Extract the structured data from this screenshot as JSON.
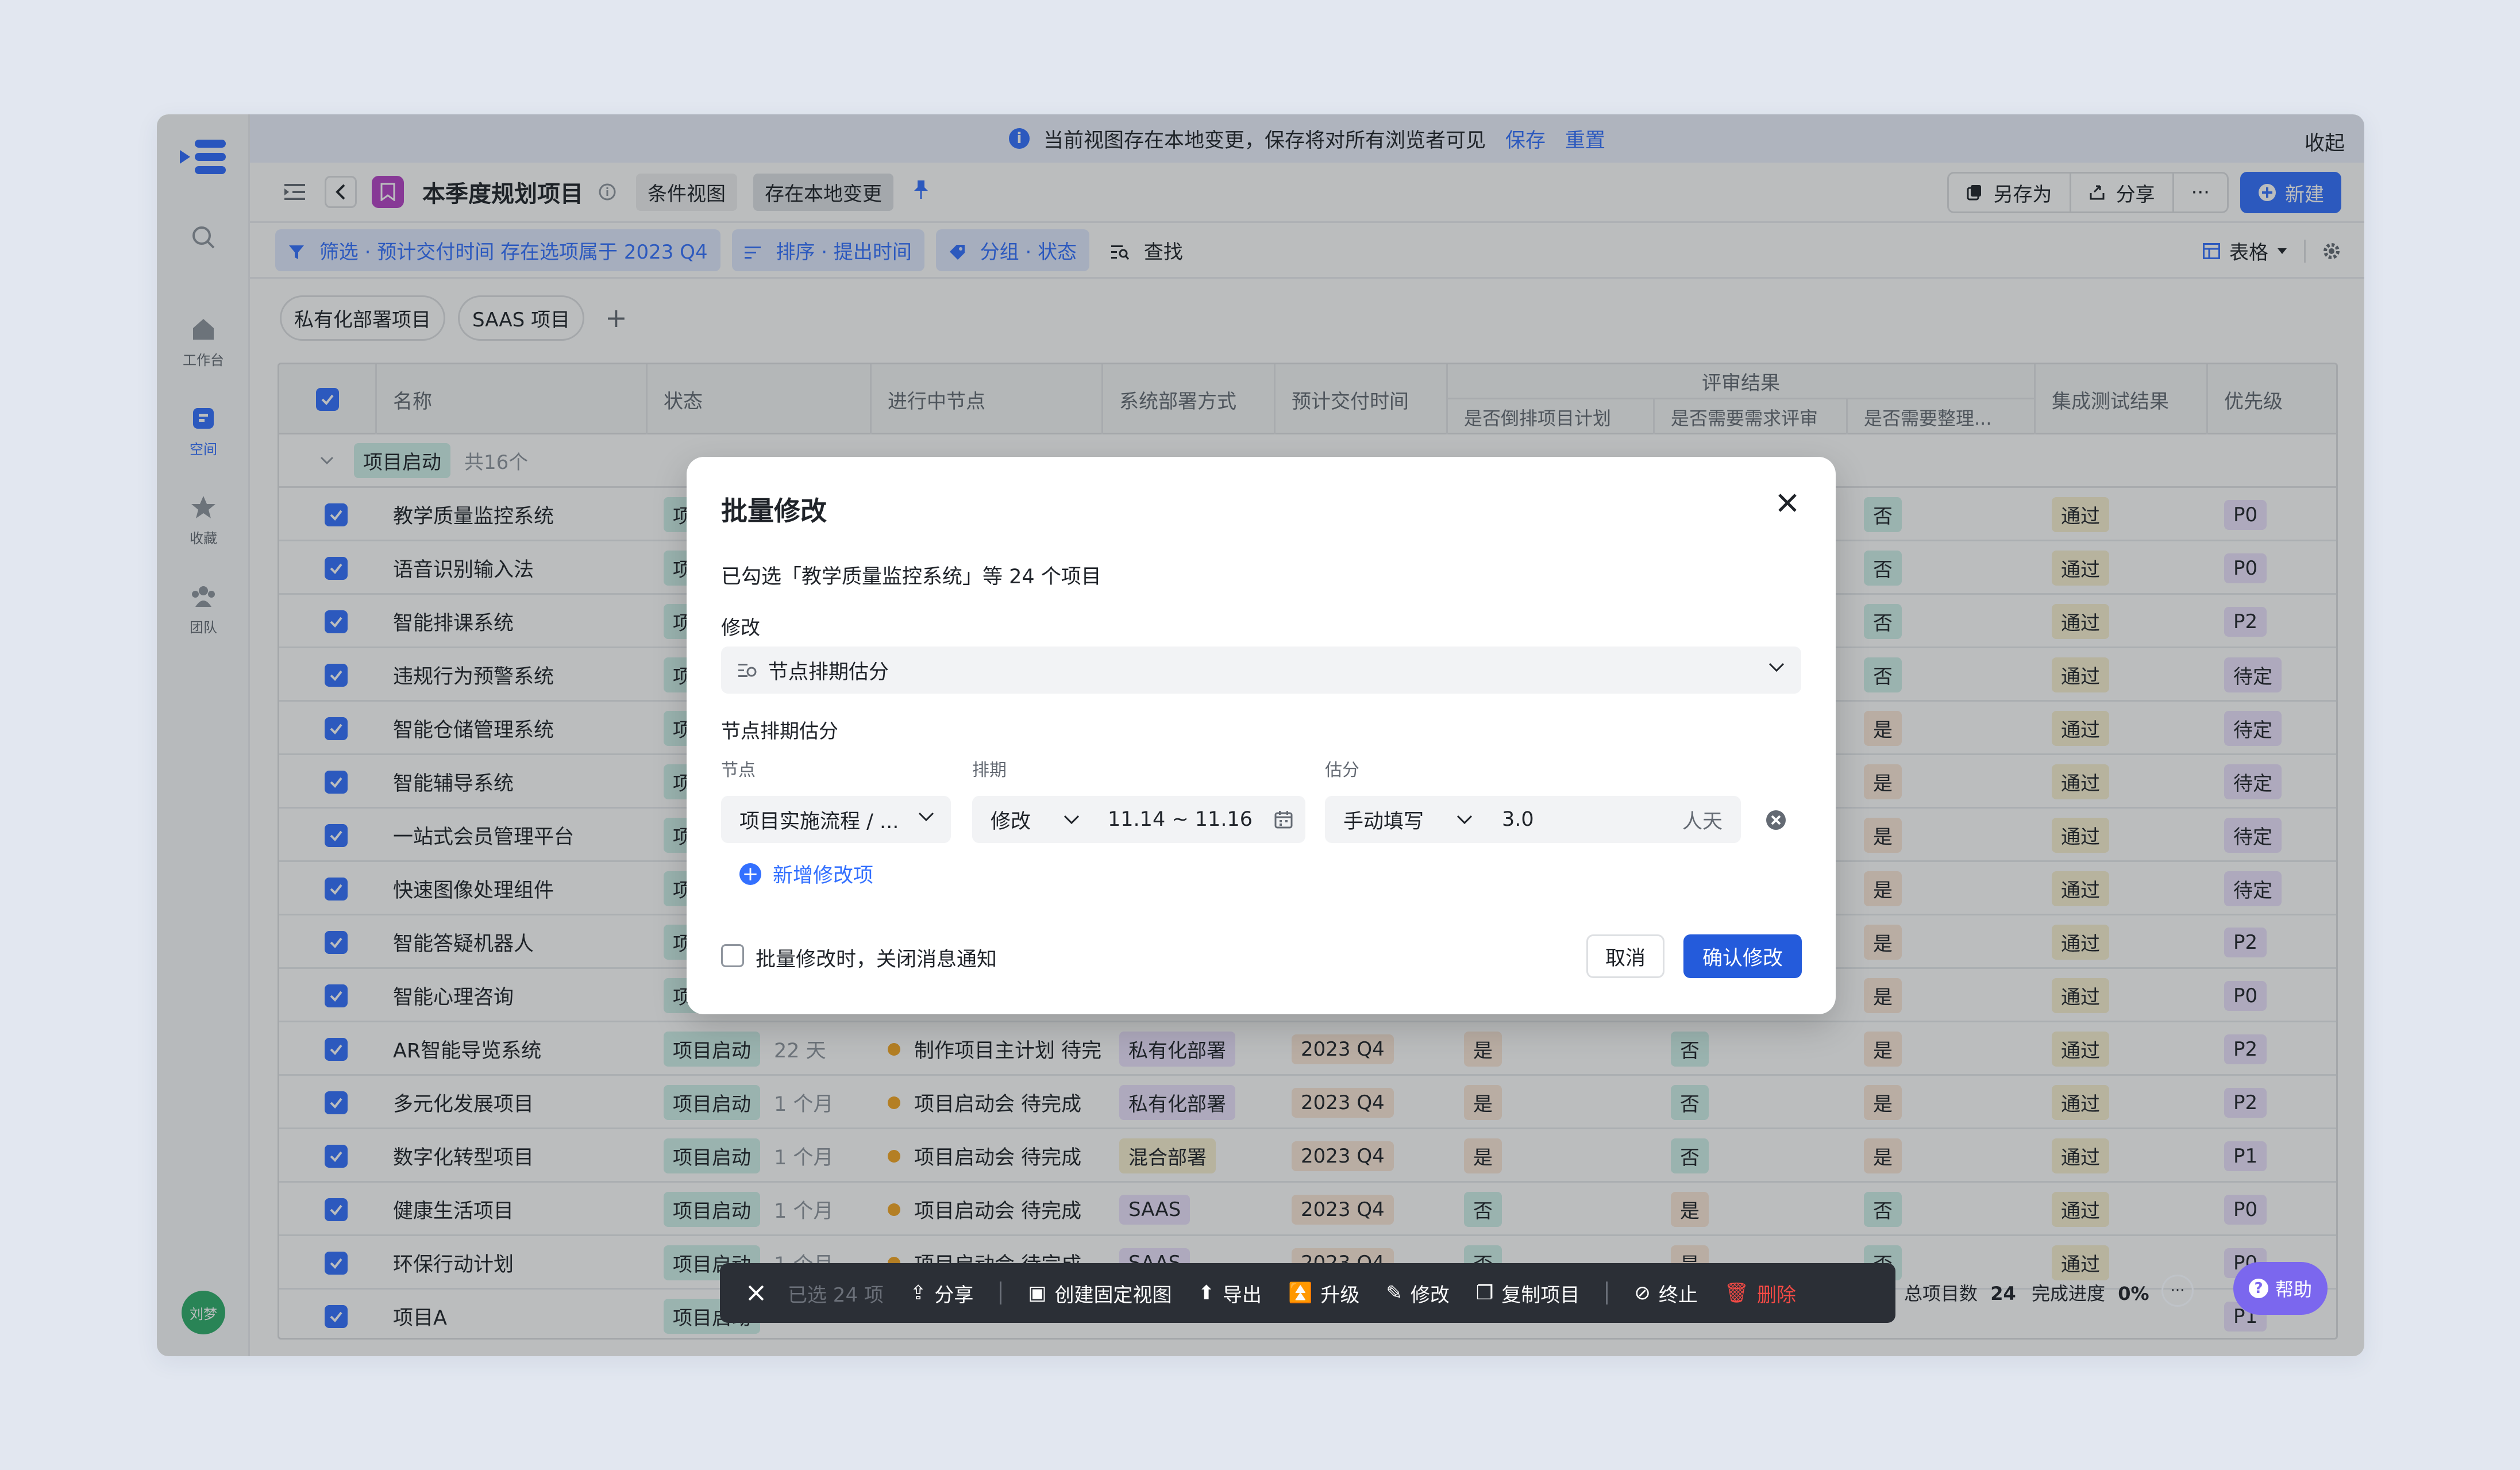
{
  "banner": {
    "text": "当前视图存在本地变更，保存将对所有浏览者可见",
    "save": "保存",
    "reset": "重置",
    "collapse": "收起"
  },
  "rail": {
    "workbench": "工作台",
    "space": "空间",
    "favorites": "收藏",
    "team": "团队",
    "avatar": "刘梦"
  },
  "titlebar": {
    "title": "本季度规划项目",
    "view_type": "条件视图",
    "local_change": "存在本地变更",
    "save_as": "另存为",
    "share": "分享",
    "more": "···",
    "new": "新建"
  },
  "filterbar": {
    "filter": "筛选 · 预计交付时间 存在选项属于 2023 Q4",
    "sort": "排序 · 提出时间",
    "group": "分组 · 状态",
    "find": "查找",
    "view_mode": "表格"
  },
  "tabs": [
    "私有化部署项目",
    "SAAS 项目"
  ],
  "table": {
    "headers": {
      "name": "名称",
      "status": "状态",
      "node": "进行中节点",
      "deploy": "系统部署方式",
      "delivery": "预计交付时间",
      "review": "评审结果",
      "review_sub1": "是否倒排项目计划",
      "review_sub2": "是否需要需求评审",
      "review_sub3": "是否需要整理...",
      "test": "集成测试结果",
      "priority": "优先级"
    },
    "group": {
      "label": "项目启动",
      "count": "共16个"
    },
    "rows": [
      {
        "name": "教学质量监控系统",
        "status": "项目启动",
        "dur": "",
        "node": "",
        "deploy": "",
        "deliv": "",
        "r1": "",
        "r2": "",
        "r3": "否",
        "test": "通过",
        "pri": "P0"
      },
      {
        "name": "语音识别输入法",
        "status": "项目启动",
        "dur": "",
        "node": "",
        "deploy": "",
        "deliv": "",
        "r1": "",
        "r2": "",
        "r3": "否",
        "test": "通过",
        "pri": "P0"
      },
      {
        "name": "智能排课系统",
        "status": "项目启动",
        "dur": "",
        "node": "",
        "deploy": "",
        "deliv": "",
        "r1": "",
        "r2": "",
        "r3": "否",
        "test": "通过",
        "pri": "P2"
      },
      {
        "name": "违规行为预警系统",
        "status": "项目启动",
        "dur": "",
        "node": "",
        "deploy": "",
        "deliv": "",
        "r1": "",
        "r2": "",
        "r3": "否",
        "test": "通过",
        "pri": "待定"
      },
      {
        "name": "智能仓储管理系统",
        "status": "项目启动",
        "dur": "",
        "node": "",
        "deploy": "",
        "deliv": "",
        "r1": "",
        "r2": "",
        "r3": "是",
        "test": "通过",
        "pri": "待定"
      },
      {
        "name": "智能辅导系统",
        "status": "项目启动",
        "dur": "",
        "node": "",
        "deploy": "",
        "deliv": "",
        "r1": "",
        "r2": "",
        "r3": "是",
        "test": "通过",
        "pri": "待定"
      },
      {
        "name": "一站式会员管理平台",
        "status": "项目启动",
        "dur": "",
        "node": "",
        "deploy": "",
        "deliv": "",
        "r1": "",
        "r2": "",
        "r3": "是",
        "test": "通过",
        "pri": "待定"
      },
      {
        "name": "快速图像处理组件",
        "status": "项目启动",
        "dur": "",
        "node": "",
        "deploy": "",
        "deliv": "",
        "r1": "",
        "r2": "",
        "r3": "是",
        "test": "通过",
        "pri": "待定"
      },
      {
        "name": "智能答疑机器人",
        "status": "项目启动",
        "dur": "",
        "node": "",
        "deploy": "",
        "deliv": "",
        "r1": "",
        "r2": "",
        "r3": "是",
        "test": "通过",
        "pri": "P2"
      },
      {
        "name": "智能心理咨询",
        "status": "项目启动",
        "dur": "",
        "node": "",
        "deploy": "",
        "deliv": "",
        "r1": "",
        "r2": "",
        "r3": "是",
        "test": "通过",
        "pri": "P0"
      },
      {
        "name": "AR智能导览系统",
        "status": "项目启动",
        "dur": "22 天",
        "node": "制作项目主计划 待完",
        "deploy": "私有化部署",
        "deliv": "2023 Q4",
        "r1": "是",
        "r2": "否",
        "r3": "是",
        "test": "通过",
        "pri": "P2"
      },
      {
        "name": "多元化发展项目",
        "status": "项目启动",
        "dur": "1 个月",
        "node": "项目启动会 待完成",
        "deploy": "私有化部署",
        "deliv": "2023 Q4",
        "r1": "是",
        "r2": "否",
        "r3": "是",
        "test": "通过",
        "pri": "P2"
      },
      {
        "name": "数字化转型项目",
        "status": "项目启动",
        "dur": "1 个月",
        "node": "项目启动会 待完成",
        "deploy": "混合部署",
        "deliv": "2023 Q4",
        "r1": "是",
        "r2": "否",
        "r3": "是",
        "test": "通过",
        "pri": "P1"
      },
      {
        "name": "健康生活项目",
        "status": "项目启动",
        "dur": "1 个月",
        "node": "项目启动会 待完成",
        "deploy": "SAAS",
        "deliv": "2023 Q4",
        "r1": "否",
        "r2": "是",
        "r3": "否",
        "test": "通过",
        "pri": "P0"
      },
      {
        "name": "环保行动计划",
        "status": "项目启动",
        "dur": "1 个月",
        "node": "项目启动会 待完成",
        "deploy": "SAAS",
        "deliv": "2023 Q4",
        "r1": "否",
        "r2": "是",
        "r3": "否",
        "test": "通过",
        "pri": "P0"
      },
      {
        "name": "项目A",
        "status": "项目启动",
        "dur": "",
        "node": "",
        "deploy": "",
        "deliv": "",
        "r1": "",
        "r2": "",
        "r3": "",
        "test": "",
        "pri": "P1"
      }
    ]
  },
  "modal": {
    "title": "批量修改",
    "selected_text": "已勾选「教学质量监控系统」等 24 个项目",
    "modify_label": "修改",
    "modify_value": "节点排期估分",
    "section_label": "节点排期估分",
    "col_node": "节点",
    "col_schedule": "排期",
    "col_estimate": "估分",
    "node_value": "项目实施流程 / ...",
    "schedule_mode": "修改",
    "schedule_range": "11.14 ~ 11.16",
    "estimate_mode": "手动填写",
    "estimate_value": "3.0",
    "estimate_unit": "人天",
    "add_item": "新增修改项",
    "notify_label": "批量修改时，关闭消息通知",
    "cancel": "取消",
    "confirm": "确认修改"
  },
  "actionbar": {
    "selected": "已选 24 项",
    "share": "分享",
    "fixed_view": "创建固定视图",
    "export": "导出",
    "upgrade": "升级",
    "edit": "修改",
    "copy": "复制项目",
    "stop": "终止",
    "delete": "删除"
  },
  "stats": {
    "total_label": "总项目数",
    "total": "24",
    "progress_label": "完成进度",
    "progress": "0%",
    "more": "···"
  },
  "help": "帮助",
  "colors": {
    "accent": "#3370ff",
    "confirm": "#245bdb",
    "danger": "#f54a45",
    "help": "#7b67ee"
  }
}
